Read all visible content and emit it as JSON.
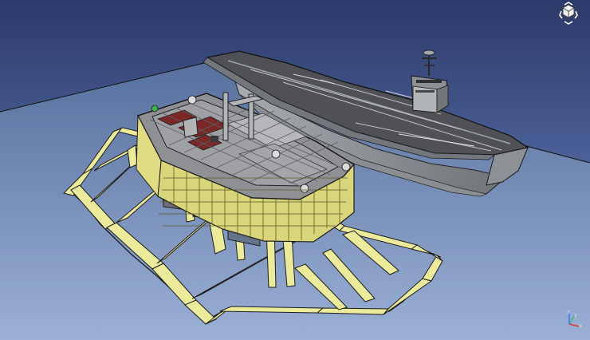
{
  "app": {
    "type": "3d-cad-viewport"
  },
  "scene": {
    "background_top": "#2c3a69",
    "background_bottom": "#8da0c9",
    "ground_plane": "#425d9c",
    "platform_frame": "#eceb9c",
    "platform_frame_stroke": "#222222",
    "ship_hull": "#8f9296",
    "ship_deck": "#4d4f54",
    "deck_marking": "#b9b9b9",
    "red_zone": "#8d2b2b"
  },
  "navigation_cube": {
    "icon": "navigation-cube-icon"
  },
  "axis": {
    "x_label": "x",
    "y_label": "y",
    "z_label": "z",
    "x_color": "#e33434",
    "y_color": "#39c45b",
    "z_color": "#4170ff"
  }
}
